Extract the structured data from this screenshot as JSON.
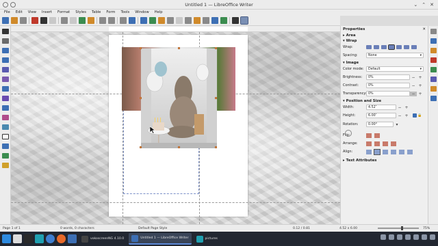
{
  "window": {
    "title": "Untitled 1 — LibreOffice Writer",
    "minimize_icon": "minimize-icon",
    "maximize_icon": "maximize-icon",
    "close_icon": "close-icon"
  },
  "menubar": [
    "File",
    "Edit",
    "View",
    "Insert",
    "Format",
    "Styles",
    "Table",
    "Form",
    "Tools",
    "Window",
    "Help"
  ],
  "sidebar": {
    "title": "Properties",
    "sections": {
      "area": "Area",
      "wrap": "Wrap",
      "image": "Image",
      "position": "Position and Size",
      "text_attributes": "Text Attributes"
    },
    "wrap": {
      "label": "Wrap:",
      "spacing_label": "Spacing:",
      "spacing_value": "None"
    },
    "image": {
      "color_mode_label": "Color mode:",
      "color_mode_value": "Default",
      "brightness_label": "Brightness:",
      "brightness_value": "0%",
      "contrast_label": "Contrast:",
      "contrast_value": "0%",
      "transparency_label": "Transparency:",
      "transparency_value": "0%"
    },
    "position": {
      "width_label": "Width:",
      "width_value": "4.52″",
      "height_label": "Height:",
      "height_value": "6.00″",
      "rotation_label": "Rotation:",
      "rotation_value": "0.00°",
      "flip_label": "Flip:",
      "arrange_label": "Arrange:",
      "align_label": "Align:"
    }
  },
  "statusbar": {
    "page": "Page 1 of 1",
    "words": "0 words, 0 characters",
    "page_style": "Default Page Style",
    "position": "0.12 / 0.81",
    "size": "4.52 x 6.00",
    "zoom": "75%"
  },
  "taskbar": {
    "tasks": [
      {
        "label": "vokoscreenNG 4.10.0",
        "active": false
      },
      {
        "label": "Untitled 1 — LibreOffice Writer",
        "active": true
      },
      {
        "label": "pictures",
        "active": false
      }
    ],
    "clock": "",
    "zoom_fraction": 0.57
  },
  "colors": {
    "accent": "#3d6fb4",
    "taskbar": "#222731",
    "handle": "#e8a868"
  }
}
